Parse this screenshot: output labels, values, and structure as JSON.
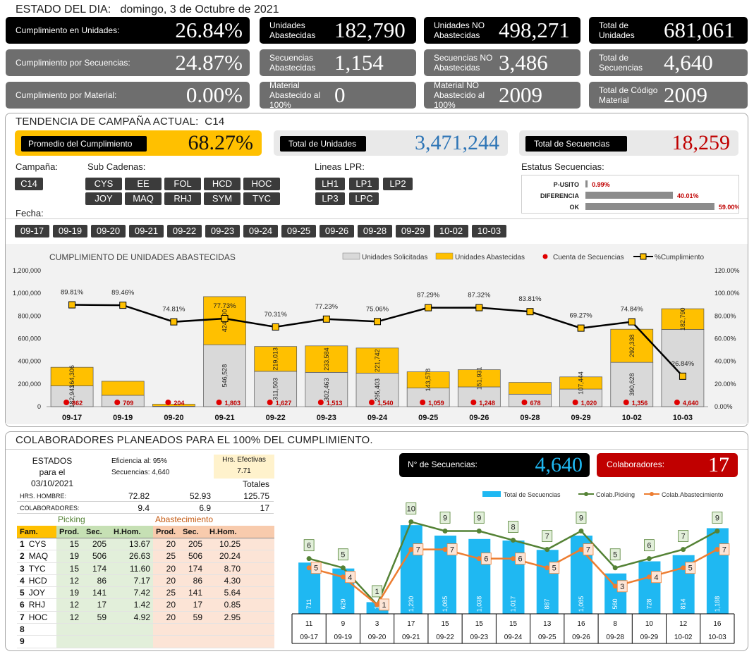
{
  "header": {
    "label": "ESTADO DEL DIA:",
    "date": "domingo, 3 de Octubre de 2021"
  },
  "kpis": [
    {
      "label": "Cumplimiento en Unidades:",
      "value": "26.84%",
      "style": "black"
    },
    {
      "label": "Unidades Abastecidas",
      "value": "182,790",
      "style": "black"
    },
    {
      "label": "Unidades NO Abastecidas",
      "value": "498,271",
      "style": "black"
    },
    {
      "label": "Total de Unidades",
      "value": "681,061",
      "style": "black"
    },
    {
      "label": "Cumplimiento por Secuencias:",
      "value": "24.87%",
      "style": "grey"
    },
    {
      "label": "Secuencias Abastecidas",
      "value": "1,154",
      "style": "grey"
    },
    {
      "label": "Secuencias NO Abastecidas",
      "value": "3,486",
      "style": "grey"
    },
    {
      "label": "Total de Secuencias",
      "value": "4,640",
      "style": "grey"
    },
    {
      "label": "Cumplimiento por Material:",
      "value": "0.00%",
      "style": "grey"
    },
    {
      "label": "Material Abastecido al 100%",
      "value": "0",
      "style": "grey"
    },
    {
      "label": "Material NO Abastecido al 100%",
      "value": "2009",
      "style": "grey"
    },
    {
      "label": "Total de Código Material",
      "value": "2009",
      "style": "grey"
    }
  ],
  "trend": {
    "title": "TENDENCIA DE CAMPAÑA ACTUAL:",
    "campaign": "C14",
    "avg_label": "Promedio  del Cumplimiento",
    "avg_value": "68.27%",
    "units_label": "Total de Unidades",
    "units_value": "3,471,244",
    "seq_label": "Total de Secuencias",
    "seq_value": "18,259",
    "colors": {
      "avg_bg": "#ffc000",
      "units_value": "#2e75b6",
      "seq_value": "#c00000"
    }
  },
  "filters": {
    "campana_label": "Campaña:",
    "campanas": [
      "C14"
    ],
    "sub_label": "Sub Cadenas:",
    "subcadenas": [
      "CYS",
      "EE",
      "FOL",
      "HCD",
      "HOC",
      "JOY",
      "MAQ",
      "RHJ",
      "SYM",
      "TYC"
    ],
    "lineas_label": "Lineas LPR:",
    "lineas": [
      "LH1",
      "LP1",
      "LP2",
      "LP3",
      "LPC"
    ],
    "fecha_label": "Fecha:",
    "fechas": [
      "09-17",
      "09-19",
      "09-20",
      "09-21",
      "09-22",
      "09-23",
      "09-24",
      "09-25",
      "09-26",
      "09-28",
      "09-29",
      "10-02",
      "10-03"
    ],
    "estatus_label": "Estatus Secuencias:",
    "estatus": [
      {
        "name": "P-USITO",
        "value": 0.99,
        "label": "0.99%"
      },
      {
        "name": "DIFERENCIA",
        "value": 40.01,
        "label": "40.01%"
      },
      {
        "name": "OK",
        "value": 59.0,
        "label": "59.00%"
      }
    ]
  },
  "chart_data": [
    {
      "type": "bar",
      "title": "CUMPLIMIENTO DE UNIDADES ABASTECIDAS",
      "categories": [
        "09-17",
        "09-19",
        "09-20",
        "09-21",
        "09-22",
        "09-23",
        "09-24",
        "09-25",
        "09-26",
        "09-28",
        "09-29",
        "10-02",
        "10-03"
      ],
      "legend": [
        "Unidades Solicitadas",
        "Unidades Abastecidas",
        "Cuenta de Secuencias",
        "%Cumplimiento"
      ],
      "y_ticks": [
        "0",
        "200,000",
        "400,000",
        "600,000",
        "800,000",
        "1,000,000",
        "1,200,000"
      ],
      "y2_ticks": [
        "0.00%",
        "20.00%",
        "40.00%",
        "60.00%",
        "80.00%",
        "100.00%",
        "120.00%"
      ],
      "ylim": [
        0,
        1200000
      ],
      "y2lim": [
        0,
        120
      ],
      "series": [
        {
          "name": "Unidades Solicitadas",
          "values": [
            182943,
            100000,
            4000,
            546528,
            311503,
            302463,
            295403,
            164000,
            174000,
            110000,
            155000,
            390628,
            681061
          ],
          "labels": [
            "182,943",
            "",
            "",
            "546,528",
            "311,503",
            "302,463",
            "295,403",
            "",
            "",
            "",
            "",
            "390,628",
            ""
          ]
        },
        {
          "name": "Unidades Abastecidas",
          "values": [
            164306,
            124000,
            18000,
            424000,
            219013,
            233584,
            221742,
            143578,
            151931,
            103839,
            107444,
            292338,
            182790
          ],
          "labels": [
            "164,306",
            "",
            "",
            "424,000",
            "219,013",
            "233,584",
            "221,742",
            "143,578",
            "151,931",
            "",
            "107,444",
            "292,338",
            "182,790"
          ]
        },
        {
          "name": "Cuenta de Secuencias",
          "values": [
            862,
            709,
            204,
            1803,
            1627,
            1513,
            1540,
            1059,
            1248,
            678,
            1020,
            1356,
            4640
          ],
          "labels": [
            "862",
            "709",
            "204",
            "1,803",
            "1,627",
            "1,513",
            "1,540",
            "1,059",
            "1,248",
            "678",
            "1,020",
            "1,356",
            "4,640"
          ]
        },
        {
          "name": "%Cumplimiento",
          "values": [
            89.81,
            89.46,
            74.81,
            77.73,
            70.31,
            77.23,
            75.06,
            87.29,
            87.32,
            83.81,
            69.27,
            74.84,
            26.84
          ],
          "labels": [
            "89.81%",
            "89.46%",
            "74.81%",
            "77.73%",
            "70.31%",
            "77.23%",
            "75.06%",
            "87.29%",
            "87.32%",
            "83.81%",
            "69.27%",
            "74.84%",
            "26.84%"
          ]
        }
      ]
    },
    {
      "type": "bar",
      "categories": [
        "09-17",
        "09-19",
        "09-20",
        "09-21",
        "09-22",
        "09-23",
        "09-24",
        "09-25",
        "09-26",
        "09-28",
        "09-29",
        "10-02",
        "10-03"
      ],
      "legend": [
        "Total de Secuencias",
        "Colab.Picking",
        "Colab.Abastecimiento"
      ],
      "series": [
        {
          "name": "Total de Secuencias",
          "values": [
            711,
            629,
            162,
            1230,
            1085,
            1038,
            1017,
            887,
            1085,
            560,
            728,
            814,
            1188
          ],
          "labels": [
            "711",
            "629",
            "162",
            "1,230",
            "1,085",
            "1,038",
            "1,017",
            "887",
            "1,085",
            "560",
            "728",
            "814",
            "1,188"
          ]
        },
        {
          "name": "Colab.Picking",
          "values": [
            6,
            5,
            1,
            10,
            9,
            9,
            8,
            7,
            9,
            5,
            6,
            7,
            9
          ]
        },
        {
          "name": "Colab.Abastecimiento",
          "values": [
            5,
            4,
            1,
            7,
            7,
            6,
            6,
            5,
            7,
            3,
            4,
            5,
            7
          ]
        }
      ],
      "table_row": [
        "11",
        "9",
        "3",
        "17",
        "15",
        "15",
        "15",
        "13",
        "16",
        "8",
        "10",
        "12",
        "16"
      ]
    }
  ],
  "colab": {
    "title": "COLABORADORES PLANEADOS PARA EL 100% DEL CUMPLIMIENTO.",
    "estados_l1": "ESTADOS",
    "estados_l2": "para el",
    "estados_l3": "03/10/2021",
    "eficiencia_label": "Eficiencia al:",
    "eficiencia_value": "95%",
    "secuencias_label": "Secuencias:",
    "secuencias_value": "4,640",
    "hrs_label": "Hrs. Efectivas",
    "hrs_value": "7.71",
    "totales_label": "Totales",
    "hrs_hombre_label": "HRS. HOMBRE:",
    "hrs_hombre": [
      "72.82",
      "52.93",
      "125.75"
    ],
    "colaboradores_label": "COLABORADORES:",
    "colaboradores": [
      "9.4",
      "6.9",
      "17"
    ],
    "picking_label": "Picking",
    "abast_label": "Abastecimiento",
    "headers": [
      "Fam.",
      "Prod.",
      "Sec.",
      "H.Hom.",
      "Prod.",
      "Sec.",
      "H.Hom."
    ],
    "rows": [
      [
        "1",
        "CYS",
        "15",
        "205",
        "13.67",
        "20",
        "205",
        "10.25"
      ],
      [
        "2",
        "MAQ",
        "19",
        "506",
        "26.63",
        "25",
        "506",
        "20.24"
      ],
      [
        "3",
        "TYC",
        "15",
        "174",
        "11.60",
        "20",
        "174",
        "8.70"
      ],
      [
        "4",
        "HCD",
        "12",
        "86",
        "7.17",
        "20",
        "86",
        "4.30"
      ],
      [
        "5",
        "JOY",
        "19",
        "141",
        "7.42",
        "25",
        "141",
        "5.64"
      ],
      [
        "6",
        "RHJ",
        "12",
        "17",
        "1.42",
        "20",
        "17",
        "0.85"
      ],
      [
        "7",
        "HOC",
        "12",
        "59",
        "4.92",
        "20",
        "59",
        "2.95"
      ],
      [
        "8",
        "",
        "",
        "",
        "",
        "",
        "",
        ""
      ],
      [
        "9",
        "",
        "",
        "",
        "",
        "",
        "",
        ""
      ]
    ],
    "nseq_label": "N° de Secuencias:",
    "nseq_value": "4,640",
    "colab_label": "Colaboradores:",
    "colab_value": "17"
  }
}
